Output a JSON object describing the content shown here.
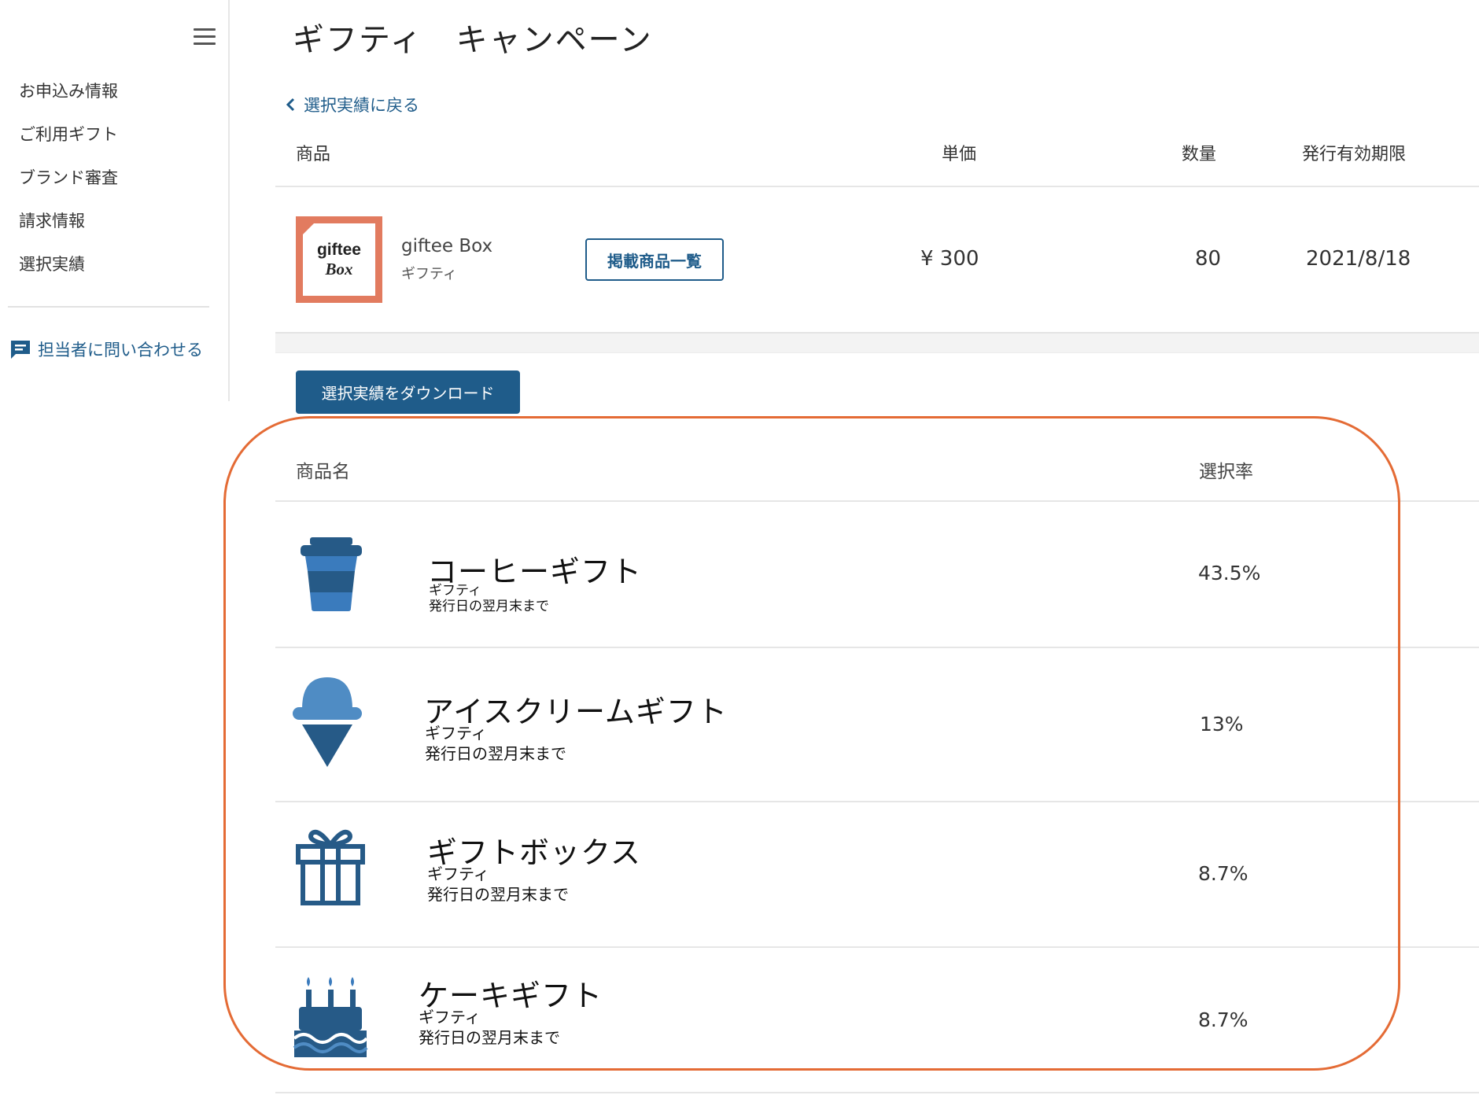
{
  "sidebar": {
    "menu_icon": "hamburger-menu-icon",
    "items": [
      {
        "label": "お申込み情報"
      },
      {
        "label": "ご利用ギフト"
      },
      {
        "label": "ブランド審査"
      },
      {
        "label": "請求情報"
      },
      {
        "label": "選択実績"
      }
    ],
    "contact_icon": "chat-bubble-icon",
    "contact_label": "担当者に問い合わせる"
  },
  "page": {
    "title": "ギフティ　キャンペーン",
    "back_label": "選択実績に戻る",
    "back_icon": "chevron-left-icon"
  },
  "summary_table": {
    "headers": {
      "product": "商品",
      "unit_price": "単価",
      "quantity": "数量",
      "expiry": "発行有効期限"
    },
    "row": {
      "logo_line1": "giftee",
      "logo_line2": "Box",
      "name": "giftee Box",
      "brand": "ギフティ",
      "list_button": "掲載商品一覧",
      "unit_price": "¥ 300",
      "quantity": "80",
      "expiry": "2021/8/18"
    }
  },
  "download_button": "選択実績をダウンロード",
  "results_table": {
    "headers": {
      "name": "商品名",
      "rate": "選択率"
    },
    "rows": [
      {
        "icon": "coffee-cup-icon",
        "name": "コーヒーギフト",
        "brand": "ギフティ",
        "validity": "発行日の翌月末まで",
        "rate": "43.5%"
      },
      {
        "icon": "ice-cream-icon",
        "name": "アイスクリームギフト",
        "brand": "ギフティ",
        "validity": "発行日の翌月末まで",
        "rate": "13%"
      },
      {
        "icon": "gift-box-icon",
        "name": "ギフトボックス",
        "brand": "ギフティ",
        "validity": "発行日の翌月末まで",
        "rate": "8.7%"
      },
      {
        "icon": "cake-icon",
        "name": "ケーキギフト",
        "brand": "ギフティ",
        "validity": "発行日の翌月末まで",
        "rate": "8.7%"
      }
    ]
  },
  "colors": {
    "accent": "#1f5c8a",
    "highlight": "#e46b35",
    "logo_bg": "#e27b5f",
    "icon_dark": "#265a87",
    "icon_light": "#3a7bbd"
  }
}
